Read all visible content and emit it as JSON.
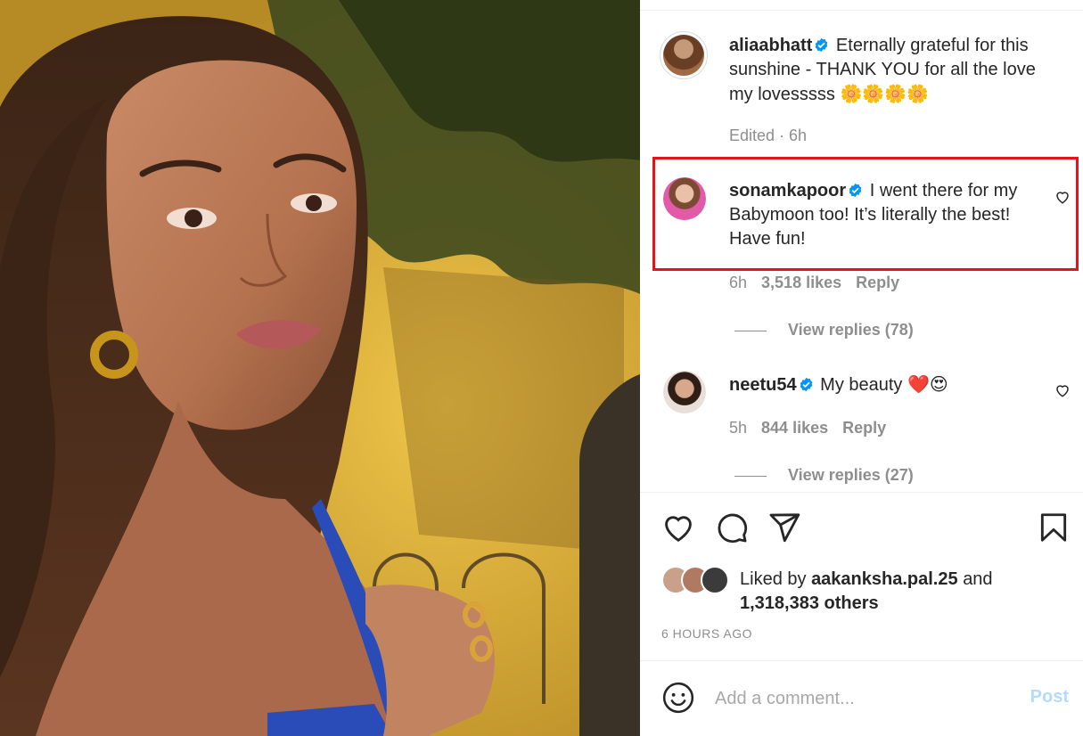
{
  "post": {
    "image_alt": "Selfie in warm sunlight",
    "caption": {
      "username": "aliaabhatt",
      "text": "Eternally grateful for this sunshine - THANK YOU for all the love my lovesssss",
      "emojis": "🌼🌼🌼🌼",
      "meta": "Edited · 6h"
    }
  },
  "comments": [
    {
      "username": "sonamkapoor",
      "text": "I went there for my Babymoon too! It’s literally the best! Have fun!",
      "time": "6h",
      "likes": "3,518 likes",
      "reply": "Reply",
      "view_replies": "View replies (78)"
    },
    {
      "username": "neetu54",
      "text": "My beauty",
      "emojis": "❤️😍",
      "time": "5h",
      "likes": "844 likes",
      "reply": "Reply",
      "view_replies": "View replies (27)"
    }
  ],
  "liked_by": {
    "prefix": "Liked by",
    "user": "aakanksha.pal.25",
    "and": "and",
    "others": "1,318,383 others"
  },
  "timestamp": "6 HOURS AGO",
  "comment_box": {
    "placeholder": "Add a comment...",
    "post_label": "Post"
  },
  "icons": {
    "like": "heart-icon",
    "comment": "comment-icon",
    "share": "share-icon",
    "save": "bookmark-icon",
    "emoji": "emoji-icon",
    "verified": "verified-badge-icon"
  },
  "colors": {
    "highlight": "#e4141b",
    "verified": "#0095f6",
    "muted": "#8e8e8e",
    "post_disabled": "#b3dbff"
  }
}
